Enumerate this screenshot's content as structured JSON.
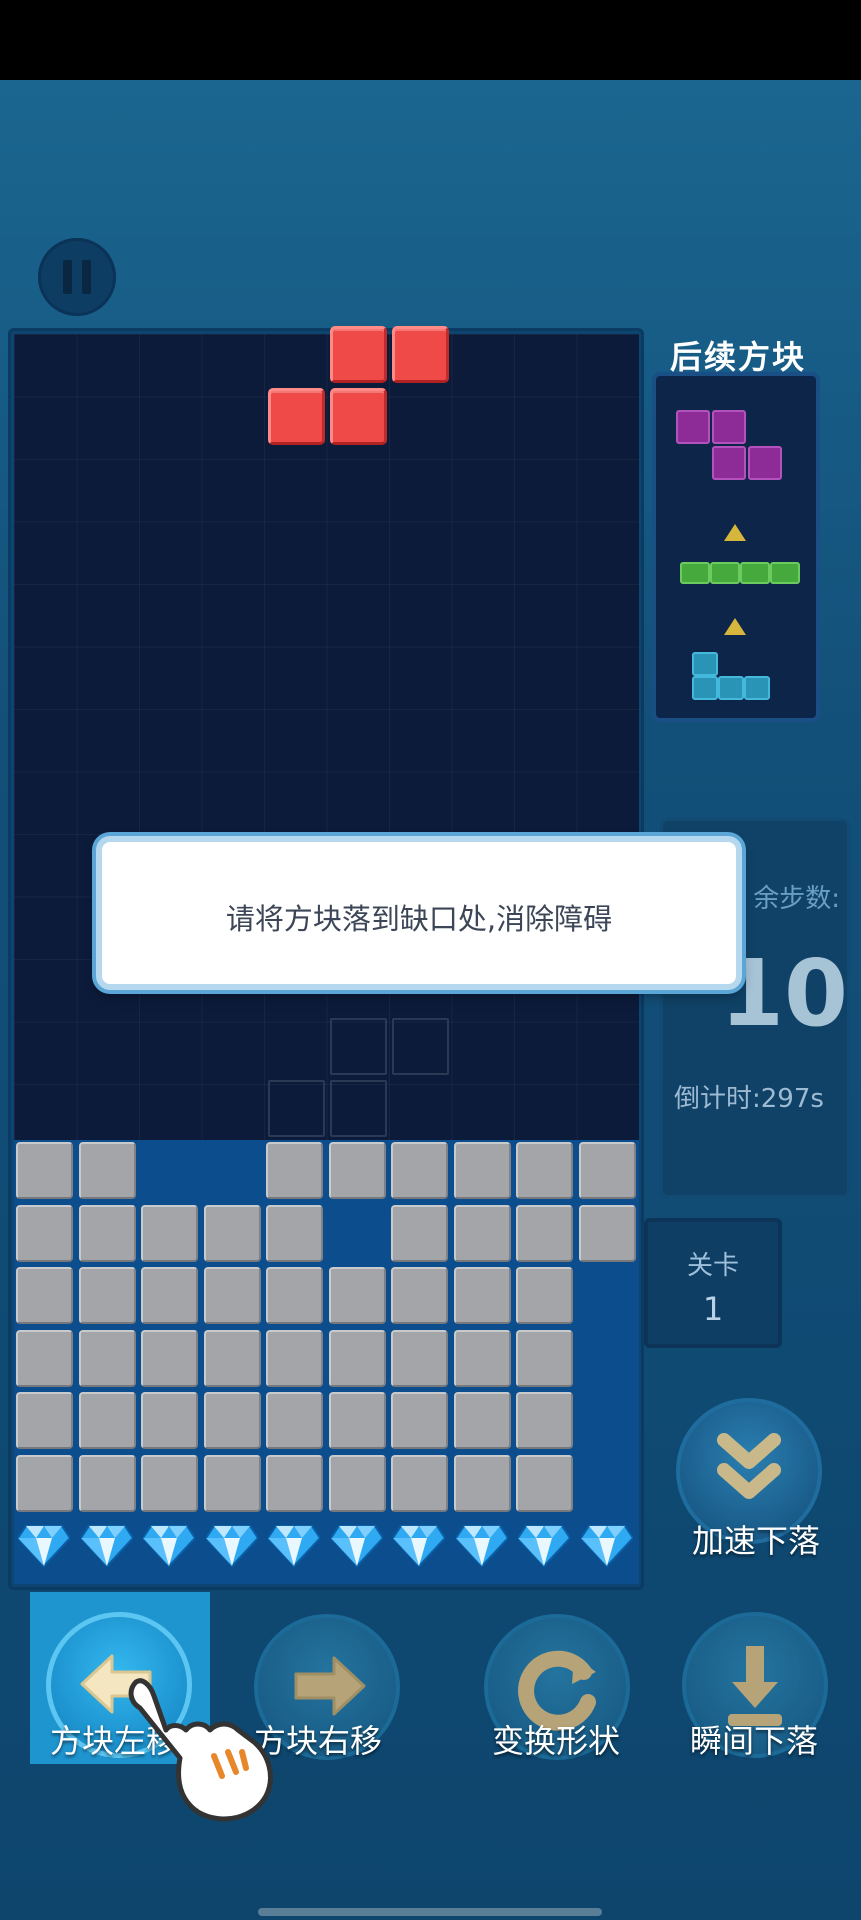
{
  "game": {
    "next_label": "后续方块",
    "hint": "请将方块落到缺口处,消除障碍",
    "steps_label": "余步数:",
    "steps_value": "10",
    "countdown": "倒计时:297s",
    "level_label": "关卡",
    "level_value": "1"
  },
  "controls": {
    "drop_faster": "加速下落",
    "move_left": "方块左移",
    "move_right": "方块右移",
    "rotate": "变换形状",
    "instant_drop": "瞬间下落"
  },
  "icons": {
    "pause": "pause-icon",
    "fast_drop": "double-chevron-down-icon",
    "left": "arrow-left-icon",
    "right": "arrow-right-icon",
    "rotate": "rotate-icon",
    "instant": "arrow-down-to-line-icon",
    "tutorial_hand": "pointing-hand-icon",
    "gem": "diamond-icon"
  },
  "colors": {
    "active_piece": "#ef4a48",
    "locked_block": "#a3a5a8",
    "next_s_piece": "#8d2c96",
    "next_i_piece": "#45a93d",
    "next_l_piece": "#2a94b6",
    "highlight": "#1f95cf"
  },
  "board": {
    "columns": 10,
    "rows_filled": [
      [
        1,
        1,
        0,
        0,
        1,
        1,
        1,
        1,
        1,
        1
      ],
      [
        1,
        1,
        1,
        1,
        1,
        0,
        1,
        1,
        1,
        1
      ],
      [
        1,
        1,
        1,
        1,
        1,
        1,
        1,
        1,
        1,
        0
      ],
      [
        1,
        1,
        1,
        1,
        1,
        1,
        1,
        1,
        1,
        0
      ],
      [
        1,
        1,
        1,
        1,
        1,
        1,
        1,
        1,
        1,
        0
      ],
      [
        1,
        1,
        1,
        1,
        1,
        1,
        1,
        1,
        1,
        0
      ]
    ],
    "gem_count": 10
  }
}
